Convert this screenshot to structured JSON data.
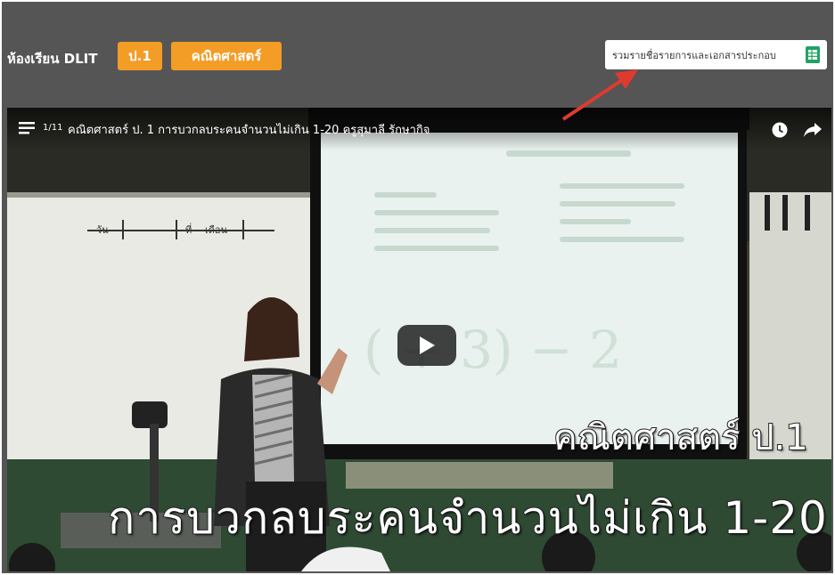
{
  "header": {
    "room_title": "ห้องเรียน DLIT",
    "grade_badge": "ป.1",
    "subject_badge": "คณิตศาสตร์",
    "docs_button_label": "รวมรายชื่อรายการและเอกสารประกอบ",
    "docs_icon": "spreadsheet-icon"
  },
  "video": {
    "playlist_index": "1/11",
    "title": "คณิตศาสตร์ ป. 1 การบวกลบระคนจำนวนไม่เกิน 1-20 ครูสุมาลี รักษากิจ",
    "icons": [
      "playlist-icon",
      "watch-later-icon",
      "share-icon",
      "play-icon"
    ],
    "overlay_subject": "คณิตศาสตร์ ป.1",
    "overlay_lesson": "การบวกลบระคนจำนวนไม่เกิน 1-20",
    "board_labels": {
      "day": "วัน",
      "date": "ที่",
      "month": "เดือน"
    },
    "screen_expression": "(     + 3) − 2"
  },
  "colors": {
    "header_bg": "#555555",
    "badge_orange": "#f39c26",
    "arrow_red": "#e03a2f",
    "sheet_green": "#21a366"
  }
}
